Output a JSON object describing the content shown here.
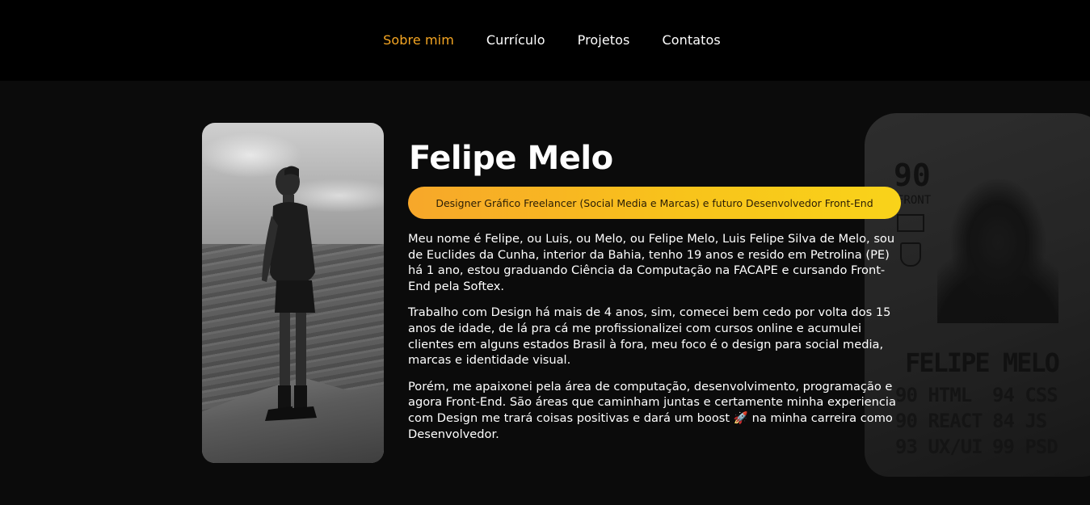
{
  "nav": {
    "items": [
      {
        "label": "Sobre mim",
        "active": true
      },
      {
        "label": "Currículo",
        "active": false
      },
      {
        "label": "Projetos",
        "active": false
      },
      {
        "label": "Contatos",
        "active": false
      }
    ],
    "active_color": "#f5a623"
  },
  "profile": {
    "name": "Felipe Melo",
    "tagline": "Designer Gráfico Freelancer (Social Media e Marcas) e futuro Desenvolvedor Front-End",
    "paragraphs": [
      "Meu nome é Felipe, ou Luis, ou Melo, ou Felipe Melo, Luis Felipe Silva de Melo, sou de Euclides da Cunha, interior da Bahia, tenho 19 anos e resido em Petrolina (PE) há 1 ano, estou graduando Ciência da Computação na FACAPE e cursando Front-End pela Softex.",
      "Trabalho com Design há mais de 4 anos, sim, comecei bem cedo por volta dos 15 anos de idade, de lá pra cá me profissionalizei com cursos online e acumulei clientes em alguns estados Brasil à fora, meu foco é o design para social media, marcas e identidade visual.",
      "Porém, me apaixonei pela área de computação, desenvolvimento, programação e agora Front-End. São áreas que caminham juntas e certamente minha experiencia com Design me trará coisas positivas e dará um boost 🚀 na minha carreira como Desenvolvedor."
    ]
  },
  "card": {
    "rating": "90",
    "position": "FRONT",
    "name": "FELIPE MELO",
    "stats": [
      "90 HTML",
      "94 CSS",
      "90 REACT",
      "84 JS",
      "93 UX/UI",
      "99 PSD"
    ]
  },
  "colors": {
    "accent": "#f5a623",
    "tagline_gradient_start": "#f7a72a",
    "tagline_gradient_end": "#f9d31a",
    "background": "#0b0b0b",
    "header": "#000000"
  }
}
